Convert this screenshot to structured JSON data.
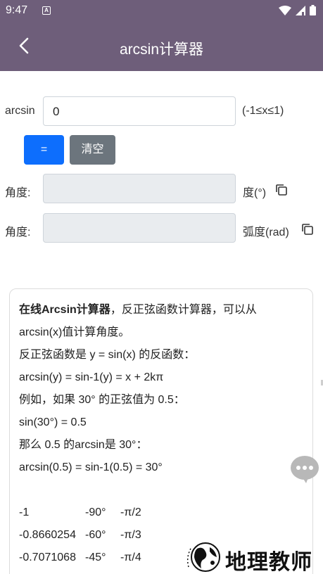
{
  "status_bar": {
    "time": "9:47",
    "notification_letter": "A"
  },
  "app_bar": {
    "title": "arcsin计算器"
  },
  "input_row": {
    "label": "arcsin",
    "value": "0",
    "range_hint": "(-1≤x≤1)"
  },
  "buttons": {
    "equals": "=",
    "clear": "清空"
  },
  "result_degree": {
    "label": "角度:",
    "value": "",
    "unit": "度(°)"
  },
  "result_radian": {
    "label": "角度:",
    "value": "",
    "unit": "弧度(rad)"
  },
  "description": {
    "intro_bold": "在线Arcsin计算器",
    "intro_rest": "，反正弦函数计算器，可以从",
    "line2": "arcsin(x)值计算角度。",
    "line3": "反正弦函数是 y = sin(x) 的反函数：",
    "line4": "arcsin(y) = sin-1(y) = x + 2kπ",
    "line5": "例如，如果 30° 的正弦值为 0.5：",
    "line6": "sin(30°) = 0.5",
    "line7": "那么 0.5 的arcsin是 30°：",
    "line8": "arcsin(0.5) = sin-1(0.5) = 30°",
    "table": [
      {
        "x": "-1",
        "deg": "-90°",
        "rad": "-π/2"
      },
      {
        "x": "-0.8660254",
        "deg": "-60°",
        "rad": "-π/3"
      },
      {
        "x": "-0.7071068",
        "deg": "-45°",
        "rad": "-π/4"
      }
    ]
  },
  "watermark": {
    "text": "地理教师"
  }
}
